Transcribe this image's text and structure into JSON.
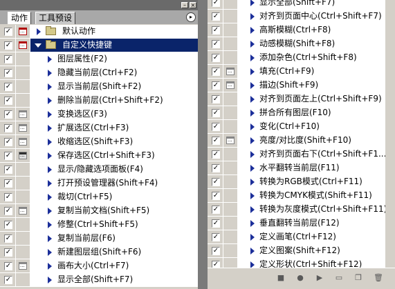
{
  "left_panel": {
    "tabs": [
      {
        "label": "动作"
      },
      {
        "label": "工具预设"
      }
    ],
    "rows": [
      {
        "type": "set",
        "label": "默认动作",
        "checked": true,
        "dialog": "red",
        "expanded": false
      },
      {
        "type": "set",
        "label": "自定义快捷键",
        "checked": true,
        "dialog": "red",
        "expanded": true,
        "selected": true
      },
      {
        "type": "action",
        "label": "图层属性(F2)",
        "checked": true,
        "dialog": ""
      },
      {
        "type": "action",
        "label": "隐藏当前层(Ctrl+F2)",
        "checked": true,
        "dialog": ""
      },
      {
        "type": "action",
        "label": "显示当前层(Shift+F2)",
        "checked": true,
        "dialog": ""
      },
      {
        "type": "action",
        "label": "删除当前层(Ctrl+Shift+F2)",
        "checked": true,
        "dialog": ""
      },
      {
        "type": "action",
        "label": "变换选区(F3)",
        "checked": true,
        "dialog": "gray"
      },
      {
        "type": "action",
        "label": "扩展选区(Ctrl+F3)",
        "checked": true,
        "dialog": "gray"
      },
      {
        "type": "action",
        "label": "收缩选区(Shift+F3)",
        "checked": true,
        "dialog": "gray"
      },
      {
        "type": "action",
        "label": "保存选区(Ctrl+Shift+F3)",
        "checked": true,
        "dialog": "dark"
      },
      {
        "type": "action",
        "label": "显示/隐藏选项面板(F4)",
        "checked": true,
        "dialog": ""
      },
      {
        "type": "action",
        "label": "打开预设管理器(Shift+F4)",
        "checked": true,
        "dialog": ""
      },
      {
        "type": "action",
        "label": "裁切(Ctrl+F5)",
        "checked": true,
        "dialog": ""
      },
      {
        "type": "action",
        "label": "复制当前文档(Shift+F5)",
        "checked": true,
        "dialog": "gray"
      },
      {
        "type": "action",
        "label": "修整(Ctrl+Shift+F5)",
        "checked": true,
        "dialog": ""
      },
      {
        "type": "action",
        "label": "复制当前层(F6)",
        "checked": true,
        "dialog": ""
      },
      {
        "type": "action",
        "label": "新建图层组(Shift+F6)",
        "checked": true,
        "dialog": ""
      },
      {
        "type": "action",
        "label": "画布大小(Ctrl+F7)",
        "checked": true,
        "dialog": "gray"
      },
      {
        "type": "action",
        "label": "显示全部(Shift+F7)",
        "checked": true,
        "dialog": ""
      }
    ]
  },
  "right_panel": {
    "rows": [
      {
        "label": "显示全部(Shift+F7)",
        "checked": true,
        "dialog": ""
      },
      {
        "label": "对齐到页面中心(Ctrl+Shift+F7)",
        "checked": true,
        "dialog": ""
      },
      {
        "label": "高斯模糊(Ctrl+F8)",
        "checked": true,
        "dialog": ""
      },
      {
        "label": "动感模糊(Shift+F8)",
        "checked": true,
        "dialog": ""
      },
      {
        "label": "添加杂色(Ctrl+Shift+F8)",
        "checked": true,
        "dialog": ""
      },
      {
        "label": "填充(Ctrl+F9)",
        "checked": true,
        "dialog": "gray"
      },
      {
        "label": "描边(Shift+F9)",
        "checked": true,
        "dialog": "gray"
      },
      {
        "label": "对齐到页面左上(Ctrl+Shift+F9)",
        "checked": true,
        "dialog": ""
      },
      {
        "label": "拼合所有图层(F10)",
        "checked": true,
        "dialog": ""
      },
      {
        "label": "变化(Ctrl+F10)",
        "checked": true,
        "dialog": ""
      },
      {
        "label": "亮度/对比度(Shift+F10)",
        "checked": true,
        "dialog": "gray"
      },
      {
        "label": "对齐到页面右下(Ctrl+Shift+F1...",
        "checked": true,
        "dialog": ""
      },
      {
        "label": "水平翻转当前层(F11)",
        "checked": true,
        "dialog": ""
      },
      {
        "label": "转换为RGB模式(Ctrl+F11)",
        "checked": true,
        "dialog": ""
      },
      {
        "label": "转换为CMYK模式(Shift+F11)",
        "checked": true,
        "dialog": ""
      },
      {
        "label": "转换为灰度模式(Ctrl+Shift+F11)",
        "checked": true,
        "dialog": ""
      },
      {
        "label": "垂直翻转当前层(F12)",
        "checked": true,
        "dialog": ""
      },
      {
        "label": "定义画笔(Ctrl+F12)",
        "checked": true,
        "dialog": ""
      },
      {
        "label": "定义图案(Shift+F12)",
        "checked": true,
        "dialog": ""
      },
      {
        "label": "定义形状(Ctrl+Shift+F12)",
        "checked": true,
        "dialog": ""
      }
    ],
    "bottom_icons": [
      "stop-icon",
      "record-icon",
      "play-icon",
      "new-set-icon",
      "new-action-icon",
      "delete-icon"
    ]
  },
  "glyphs": {
    "check": "✓",
    "minimize": "–",
    "close": "×",
    "panel_menu": "▸"
  },
  "colors": {
    "selected_row": "#0a246a",
    "triangle": "#1c2f9a",
    "dialog_red": "#b00000"
  }
}
